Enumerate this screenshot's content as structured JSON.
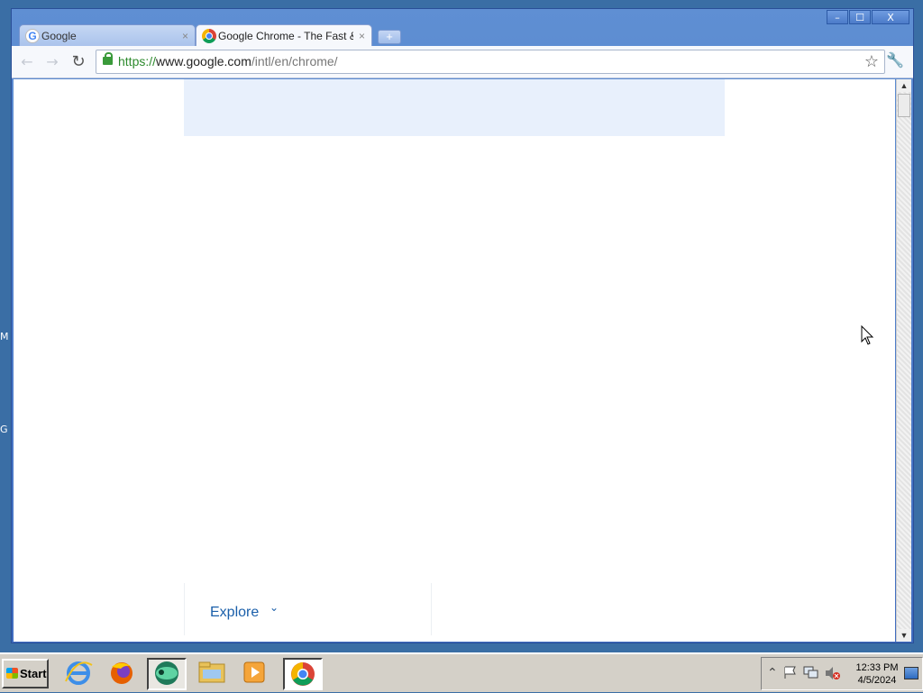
{
  "desktop": {
    "left_labels": [
      "M",
      "G"
    ]
  },
  "window": {
    "controls": {
      "minimize": "–",
      "maximize": "☐",
      "close": "X"
    },
    "tabs": [
      {
        "title": "Google",
        "close": "×",
        "favicon": "google-g-icon",
        "active": false
      },
      {
        "title": "Google Chrome - The Fast & S",
        "close": "×",
        "favicon": "chrome-icon",
        "active": true
      }
    ],
    "new_tab": "+",
    "toolbar": {
      "back": "←",
      "forward": "→",
      "reload": "↻",
      "url": {
        "scheme": "https://",
        "host": "www.google.com",
        "path": "/intl/en/chrome/"
      },
      "bookmark": "☆",
      "menu": "🔧"
    }
  },
  "page": {
    "footer_nav": {
      "explore": "Explore",
      "chevron": "⌄"
    }
  },
  "scrollbar": {
    "up": "▲",
    "down": "▼"
  },
  "taskbar": {
    "start_label": "Start",
    "apps": [
      {
        "name": "internet-explorer-icon",
        "active": false
      },
      {
        "name": "firefox-icon",
        "active": false
      },
      {
        "name": "app-icon",
        "active": false
      },
      {
        "name": "file-explorer-icon",
        "active": false
      },
      {
        "name": "media-player-icon",
        "active": false
      },
      {
        "name": "chrome-icon",
        "active": true
      }
    ],
    "tray": {
      "expand": "⌃",
      "time": "12:33 PM",
      "date": "4/5/2024"
    }
  },
  "colors": {
    "window_frame": "#4f7fcf",
    "hero_band": "#e8f0fc",
    "link": "#1a5faa",
    "url_secure": "#2d8a2d"
  }
}
